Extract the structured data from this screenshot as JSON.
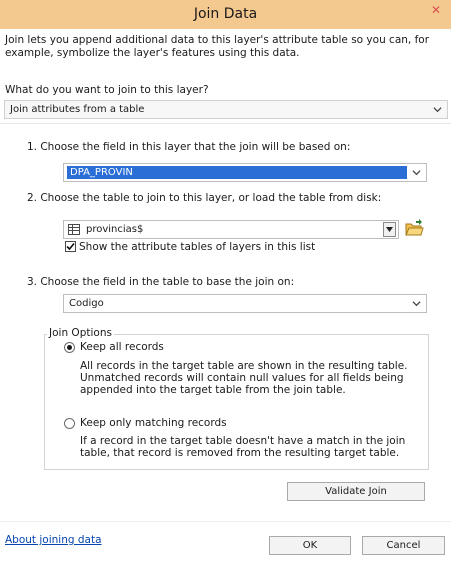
{
  "window": {
    "title": "Join Data",
    "close_icon": "x-icon"
  },
  "intro": "Join lets you append additional data to this layer's attribute table so you can, for example, symbolize the layer's features using this data.",
  "question": "What do you want to join to this layer?",
  "join_type": {
    "value": "Join attributes from a table"
  },
  "step1": {
    "label": "1.  Choose the field in this layer that the join will be based on:",
    "value": "DPA_PROVIN"
  },
  "step2": {
    "label": "2.  Choose the table to join to this layer, or load the table from disk:",
    "value": "provincias$",
    "show_layers_label": "Show the attribute tables of layers in this list",
    "show_layers_checked": true
  },
  "step3": {
    "label": "3.  Choose the field in the table to base the join on:",
    "value": "Codigo"
  },
  "join_options": {
    "title": "Join Options",
    "keep_all": {
      "label": "Keep all records",
      "desc": "All records in the target table are shown in the resulting table. Unmatched records will contain null values for all fields being appended into the target table from the join table.",
      "selected": true
    },
    "keep_matching": {
      "label": "Keep only matching records",
      "desc": "If a record in the target table doesn't have a match in the join table, that record is removed from the resulting target table.",
      "selected": false
    }
  },
  "buttons": {
    "validate": "Validate Join",
    "ok": "OK",
    "cancel": "Cancel"
  },
  "footer_link": "About joining data"
}
